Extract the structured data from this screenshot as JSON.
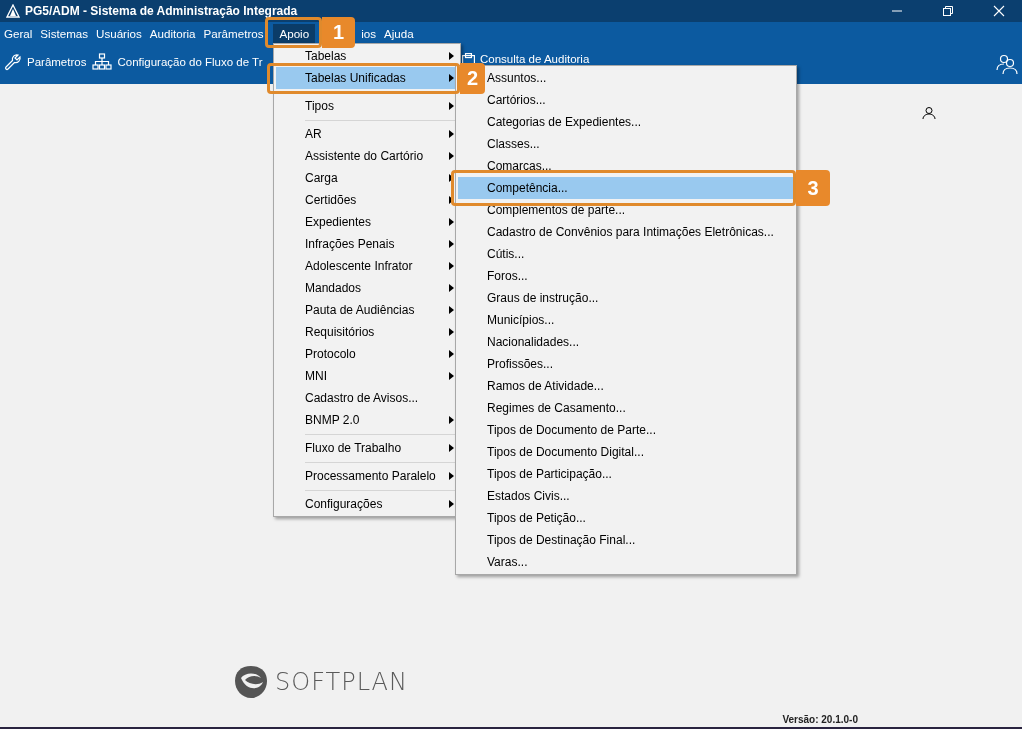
{
  "window": {
    "title": "PG5/ADM - Sistema de Administração Integrada"
  },
  "menu_bar": [
    {
      "label": "Geral",
      "selected": false
    },
    {
      "label": "Sistemas",
      "selected": false
    },
    {
      "label": "Usuários",
      "selected": false
    },
    {
      "label": "Auditoria",
      "selected": false
    },
    {
      "label": "Parâmetros",
      "selected": false
    },
    {
      "label": "Apoio",
      "selected": true
    },
    {
      "label": "ios",
      "selected": false
    },
    {
      "label": "Ajuda",
      "selected": false
    }
  ],
  "toolbar": [
    {
      "label": "Parâmetros",
      "kind": "wrench"
    },
    {
      "label": "Configuração do Fluxo de Tr",
      "kind": "hierarchy"
    },
    {
      "label": "Consulta de Auditoria",
      "kind": "clipboard"
    }
  ],
  "apoio_menu": [
    {
      "kind": "item",
      "label": "Tabelas",
      "submenu": true,
      "selected": false
    },
    {
      "kind": "item",
      "label": "Tabelas Unificadas",
      "submenu": true,
      "selected": true
    },
    {
      "kind": "separator"
    },
    {
      "kind": "item",
      "label": "Tipos",
      "submenu": true,
      "selected": false
    },
    {
      "kind": "separator"
    },
    {
      "kind": "item",
      "label": "AR",
      "submenu": true,
      "selected": false
    },
    {
      "kind": "item",
      "label": "Assistente do Cartório",
      "submenu": true,
      "selected": false
    },
    {
      "kind": "item",
      "label": "Carga",
      "submenu": true,
      "selected": false
    },
    {
      "kind": "item",
      "label": "Certidões",
      "submenu": true,
      "selected": false
    },
    {
      "kind": "item",
      "label": "Expedientes",
      "submenu": true,
      "selected": false
    },
    {
      "kind": "item",
      "label": "Infrações Penais",
      "submenu": true,
      "selected": false
    },
    {
      "kind": "item",
      "label": "Adolescente Infrator",
      "submenu": true,
      "selected": false
    },
    {
      "kind": "item",
      "label": "Mandados",
      "submenu": true,
      "selected": false
    },
    {
      "kind": "item",
      "label": "Pauta de Audiências",
      "submenu": true,
      "selected": false
    },
    {
      "kind": "item",
      "label": "Requisitórios",
      "submenu": true,
      "selected": false
    },
    {
      "kind": "item",
      "label": "Protocolo",
      "submenu": true,
      "selected": false
    },
    {
      "kind": "item",
      "label": "MNI",
      "submenu": true,
      "selected": false
    },
    {
      "kind": "item",
      "label": "Cadastro de Avisos...",
      "submenu": false,
      "selected": false
    },
    {
      "kind": "item",
      "label": "BNMP 2.0",
      "submenu": true,
      "selected": false
    },
    {
      "kind": "separator"
    },
    {
      "kind": "item",
      "label": "Fluxo de Trabalho",
      "submenu": true,
      "selected": false
    },
    {
      "kind": "separator"
    },
    {
      "kind": "item",
      "label": "Processamento Paralelo",
      "submenu": true,
      "selected": false
    },
    {
      "kind": "separator"
    },
    {
      "kind": "item",
      "label": "Configurações",
      "submenu": true,
      "selected": false
    }
  ],
  "tabelas_unificadas_menu": [
    {
      "label": "Assuntos...",
      "selected": false
    },
    {
      "label": "Cartórios...",
      "selected": false
    },
    {
      "label": "Categorias de Expedientes...",
      "selected": false
    },
    {
      "label": "Classes...",
      "selected": false
    },
    {
      "label": "Comarcas...",
      "selected": false
    },
    {
      "label": "Competência...",
      "selected": true
    },
    {
      "label": "Complementos de parte...",
      "selected": false
    },
    {
      "label": "Cadastro de Convênios para Intimações Eletrônicas...",
      "selected": false
    },
    {
      "label": "Cútis...",
      "selected": false
    },
    {
      "label": "Foros...",
      "selected": false
    },
    {
      "label": "Graus de instrução...",
      "selected": false
    },
    {
      "label": "Municípios...",
      "selected": false
    },
    {
      "label": "Nacionalidades...",
      "selected": false
    },
    {
      "label": "Profissões...",
      "selected": false
    },
    {
      "label": "Ramos de Atividade...",
      "selected": false
    },
    {
      "label": "Regimes de Casamento...",
      "selected": false
    },
    {
      "label": "Tipos de Documento de Parte...",
      "selected": false
    },
    {
      "label": "Tipos de Documento Digital...",
      "selected": false
    },
    {
      "label": "Tipos de Participação...",
      "selected": false
    },
    {
      "label": "Estados Civis...",
      "selected": false
    },
    {
      "label": "Tipos de Petição...",
      "selected": false
    },
    {
      "label": "Tipos de Destinação Final...",
      "selected": false
    },
    {
      "label": "Varas...",
      "selected": false
    }
  ],
  "callouts": [
    {
      "number": "1"
    },
    {
      "number": "2"
    },
    {
      "number": "3"
    }
  ],
  "footer": {
    "logo_text": "SOFTPLAN",
    "version": "Versão: 20.1.0-0"
  }
}
